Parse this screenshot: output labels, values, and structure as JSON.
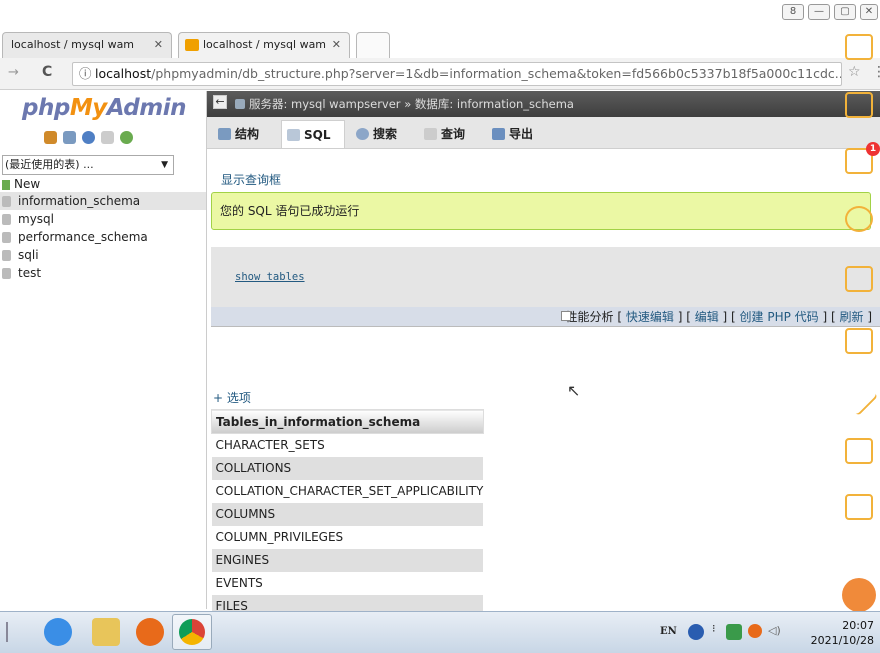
{
  "browser": {
    "tabs": [
      {
        "label": "localhost / mysql wam"
      },
      {
        "label": "localhost / mysql wam"
      }
    ],
    "url_host": "localhost",
    "url_rest": "/phpmyadmin/db_structure.php?server=1&db=information_schema&token=fd566b0c5337b18f5a000c11cdc...",
    "nav_back": "→",
    "nav_reload": "C",
    "info_icon_text": "ⓘ"
  },
  "nav": {
    "logo_php": "php",
    "logo_my": "My",
    "logo_admin": "Admin",
    "recent_select": "(最近使用的表) ...",
    "databases": [
      {
        "label": "New"
      },
      {
        "label": "information_schema"
      },
      {
        "label": "mysql"
      },
      {
        "label": "performance_schema"
      },
      {
        "label": "sqli"
      },
      {
        "label": "test"
      }
    ]
  },
  "main": {
    "breadcrumb": "服务器: mysql wampserver » 数据库: information_schema",
    "tabs": [
      {
        "label": "结构"
      },
      {
        "label": "SQL"
      },
      {
        "label": "搜索"
      },
      {
        "label": "查询"
      },
      {
        "label": "导出"
      }
    ],
    "show_query": "显示查询框",
    "success_msg": "您的 SQL 语句已成功运行",
    "sql_code": "show tables",
    "profiling_label": "性能分析",
    "links": [
      "快速编辑",
      "编辑",
      "创建 PHP 代码",
      "刷新"
    ],
    "options_link": "+ 选项",
    "table_header": "Tables_in_information_schema",
    "table_rows": [
      "CHARACTER_SETS",
      "COLLATIONS",
      "COLLATION_CHARACTER_SET_APPLICABILITY",
      "COLUMNS",
      "COLUMN_PRIVILEGES",
      "ENGINES",
      "EVENTS",
      "FILES"
    ]
  },
  "side_toolbar": {
    "badge": "1"
  },
  "taskbar": {
    "lang": "EN",
    "time": "20:07",
    "date": "2021/10/28"
  },
  "colors": {
    "accent_link": "#235a81",
    "success_bg": "#ebf8a4",
    "logo_orange": "#f29111",
    "logo_blue": "#6c78af"
  }
}
